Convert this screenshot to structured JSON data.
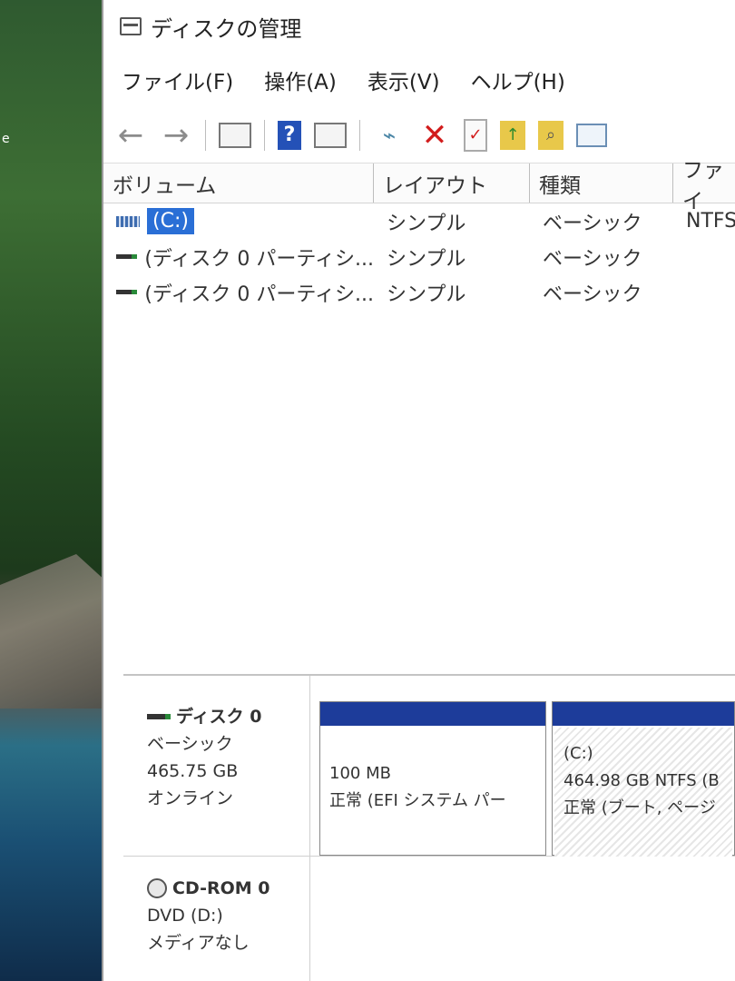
{
  "desktop": {
    "label_fragment": "e"
  },
  "window": {
    "title": "ディスクの管理",
    "icon": "disk-management-icon"
  },
  "menu": [
    {
      "label": "ファイル(F)"
    },
    {
      "label": "操作(A)"
    },
    {
      "label": "表示(V)"
    },
    {
      "label": "ヘルプ(H)"
    }
  ],
  "toolbar": {
    "back": "←",
    "forward": "→",
    "help": "?",
    "delete": "✕",
    "check": "✓"
  },
  "volume_list": {
    "columns": [
      "ボリューム",
      "レイアウト",
      "種類",
      "ファイ"
    ],
    "rows": [
      {
        "volume": "(C:)",
        "layout": "シンプル",
        "type": "ベーシック",
        "fs": "NTFS"
      },
      {
        "volume": "(ディスク 0 パーティシ...",
        "layout": "シンプル",
        "type": "ベーシック",
        "fs": ""
      },
      {
        "volume": "(ディスク 0 パーティシ...",
        "layout": "シンプル",
        "type": "ベーシック",
        "fs": ""
      }
    ]
  },
  "disk_map": {
    "disk0": {
      "name": "ディスク 0",
      "type": "ベーシック",
      "size": "465.75 GB",
      "status": "オンライン",
      "partitions": [
        {
          "label": "",
          "size": "100 MB",
          "status": "正常 (EFI システム パー"
        },
        {
          "label": "(C:)",
          "size": "464.98 GB NTFS (B",
          "status": "正常 (ブート, ページ"
        }
      ]
    },
    "cdrom0": {
      "name": "CD-ROM 0",
      "drive": "DVD (D:)",
      "status": "メディアなし"
    }
  },
  "colors": {
    "partition_header": "#1d3c9a",
    "selection": "#2a6fd6",
    "delete_icon": "#d21c1c"
  }
}
